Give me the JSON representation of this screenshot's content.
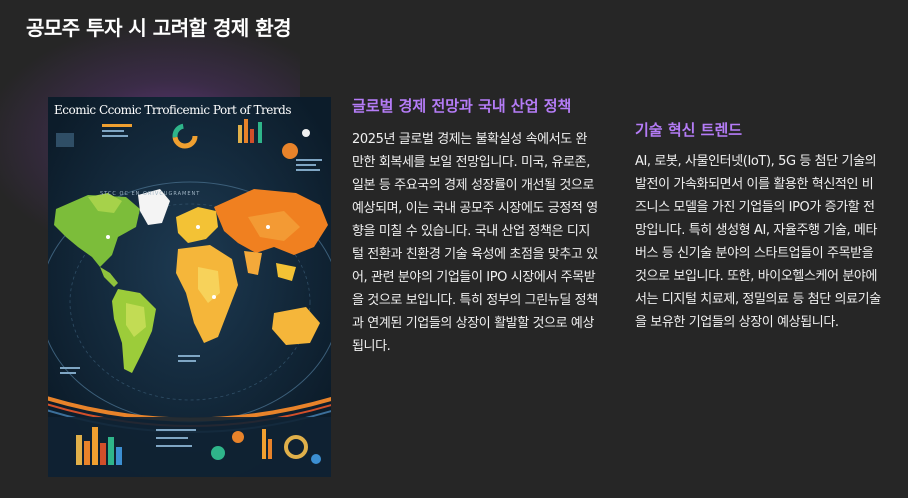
{
  "page": {
    "title": "공모주 투자 시 고려할 경제 환경"
  },
  "infographic": {
    "title": "Ecomic Ccomic Trroficemic Port of Trerds",
    "subtitle": "STCC   OC   EN   ORIVCUGRAMENT",
    "image_kind": "world-map-infographic"
  },
  "sections": [
    {
      "heading": "글로벌 경제 전망과 국내 산업 정책",
      "body": "2025년 글로벌 경제는 불확실성 속에서도 완만한 회복세를 보일 전망입니다. 미국, 유로존, 일본 등 주요국의 경제 성장률이 개선될 것으로 예상되며, 이는 국내 공모주 시장에도 긍정적 영향을 미칠 수 있습니다. 국내 산업 정책은 디지털 전환과 친환경 기술 육성에 초점을 맞추고 있어, 관련 분야의 기업들이 IPO 시장에서 주목받을 것으로 보입니다. 특히 정부의 그린뉴딜 정책과 연계된 기업들의 상장이 활발할 것으로 예상됩니다."
    },
    {
      "heading": "기술 혁신 트렌드",
      "body": "AI, 로봇, 사물인터넷(IoT), 5G 등 첨단 기술의 발전이 가속화되면서 이를 활용한 혁신적인 비즈니스 모델을 가진 기업들의 IPO가 증가할 전망입니다. 특히 생성형 AI, 자율주행 기술, 메타버스 등 신기술 분야의 스타트업들이 주목받을 것으로 보입니다. 또한, 바이오헬스케어 분야에서는 디지털 치료제, 정밀의료 등 첨단 의료기술을 보유한 기업들의 상장이 예상됩니다."
    }
  ],
  "colors": {
    "background": "#262626",
    "heading_accent": "#b57cf7",
    "glow": "#8a46c8"
  }
}
